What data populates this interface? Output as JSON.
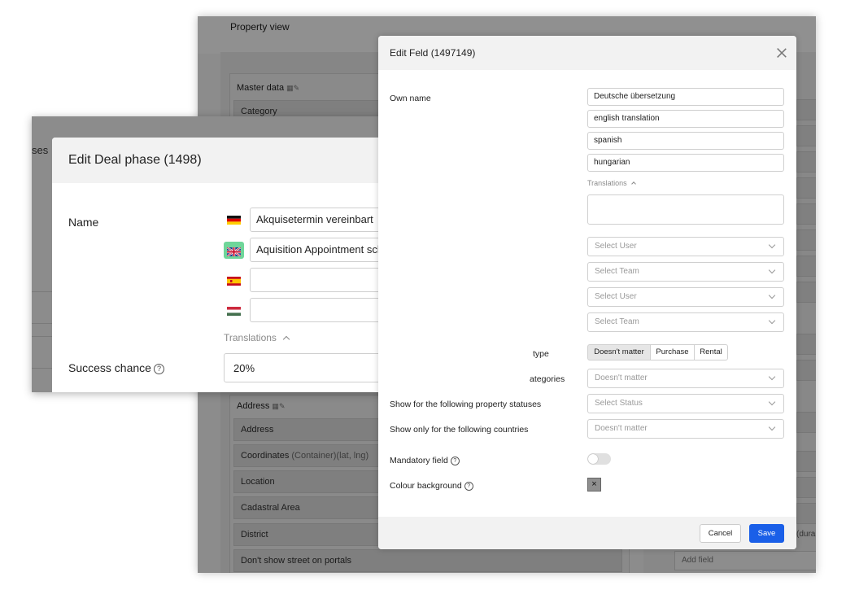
{
  "background_window": {
    "title": "Property view",
    "master_data": {
      "title": "Master data",
      "rows": [
        "Category"
      ]
    },
    "address_section": {
      "title": "Address",
      "rows": [
        {
          "label": "Address",
          "suffix": ""
        },
        {
          "label": "Coordinates",
          "suffix": "(Container)(lat, lng)"
        },
        {
          "label": "Location",
          "suffix": ""
        },
        {
          "label": "Cadastral Area",
          "suffix": ""
        },
        {
          "label": "District",
          "suffix": ""
        },
        {
          "label": "Don't show street on portals",
          "suffix": ""
        }
      ]
    },
    "right_column": {
      "add_field_placeholder": "Add field",
      "truncated_text": "(dura"
    }
  },
  "left_window": {
    "truncated_text": "ses"
  },
  "deal_modal": {
    "title": "Edit Deal phase (1498)",
    "name_label": "Name",
    "translations": [
      {
        "flag": "de-flag-icon",
        "value": ""
      },
      {
        "flag": "gb-flag-icon",
        "value": ""
      },
      {
        "flag": "es-flag-icon",
        "value": ""
      },
      {
        "flag": "hu-flag-icon",
        "value": ""
      }
    ],
    "name_values": [
      "Akquisetermin vereinbart",
      "Aquisition Appointment scheduled",
      "",
      ""
    ],
    "translations_toggle": "Translations",
    "success_chance_label": "Success chance",
    "success_chance_value": "20%"
  },
  "feld_modal": {
    "title": "Edit Feld (1497149)",
    "own_name_label": "Own name",
    "own_name_values": [
      "Deutsche übersetzung",
      "english translation",
      "spanish",
      "hungarian"
    ],
    "translations_toggle": "Translations",
    "selects": {
      "user1": "Select User",
      "team1": "Select Team",
      "user2": "Select User",
      "team2": "Select Team"
    },
    "type_label": "type",
    "type_segments": [
      "Doesn't matter",
      "Purchase",
      "Rental"
    ],
    "categories_label": "ategories",
    "categories_value": "Doesn't matter",
    "statuses_label": "Show for the following property statuses",
    "statuses_value": "Select Status",
    "countries_label": "Show only for the following countries",
    "countries_value": "Doesn't matter",
    "mandatory_label": "Mandatory field",
    "colour_label": "Colour background",
    "colour_symbol": "×",
    "cancel_label": "Cancel",
    "save_label": "Save"
  },
  "colors": {
    "accent": "#1a5fe8",
    "flag_highlight": "#6fd69a"
  }
}
